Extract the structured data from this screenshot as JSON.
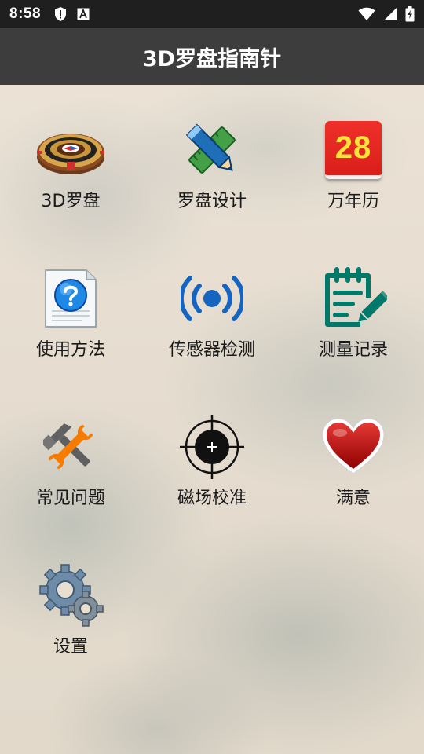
{
  "status_bar": {
    "time": "8:58",
    "left_icons": [
      "shield-alert-icon",
      "font-a-icon"
    ],
    "right_icons": [
      "wifi-icon",
      "cell-signal-icon",
      "battery-charging-icon"
    ]
  },
  "app_bar": {
    "title": "3D罗盘指南针"
  },
  "calendar_day": "28",
  "tiles": [
    {
      "label": "3D罗盘",
      "icon": "compass-3d-icon"
    },
    {
      "label": "罗盘设计",
      "icon": "design-pencil-ruler-icon"
    },
    {
      "label": "万年历",
      "icon": "calendar-icon"
    },
    {
      "label": "使用方法",
      "icon": "help-document-icon"
    },
    {
      "label": "传感器检测",
      "icon": "sensor-signal-icon"
    },
    {
      "label": "测量记录",
      "icon": "notes-edit-icon"
    },
    {
      "label": "常见问题",
      "icon": "tools-icon"
    },
    {
      "label": "磁场校准",
      "icon": "crosshair-icon"
    },
    {
      "label": "满意",
      "icon": "heart-icon"
    },
    {
      "label": "设置",
      "icon": "gears-icon"
    }
  ],
  "colors": {
    "status_bar": "#1f1f1f",
    "app_bar": "#3d3d3d",
    "background": "#e9dfd1",
    "sensor_blue": "#1565c0",
    "notes_teal": "#00796b"
  }
}
